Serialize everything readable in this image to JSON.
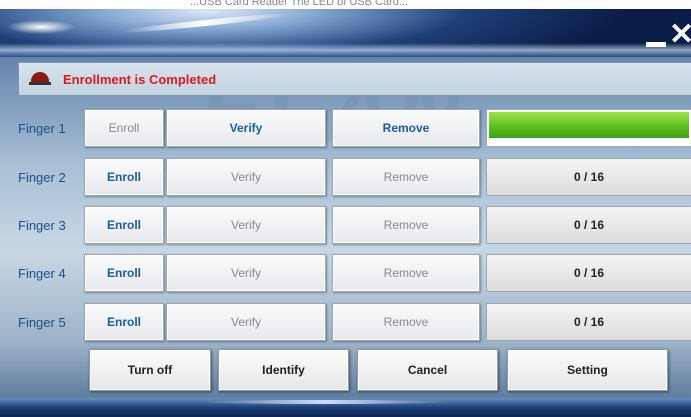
{
  "window": {
    "title_fragment": "...USB Card Reader The LED of USB Card...",
    "minimize_label": "minimize",
    "close_label": "close"
  },
  "status": {
    "message": "Enrollment is Completed",
    "led_color": "#8b1a0f"
  },
  "watermark": "ELAN",
  "fingers": [
    {
      "label": "Finger 1",
      "enroll": "Enroll",
      "verify": "Verify",
      "remove": "Remove",
      "enroll_enabled": false,
      "verify_enabled": true,
      "remove_enabled": true,
      "progress": 1.0,
      "status": ""
    },
    {
      "label": "Finger 2",
      "enroll": "Enroll",
      "verify": "Verify",
      "remove": "Remove",
      "enroll_enabled": true,
      "verify_enabled": false,
      "remove_enabled": false,
      "status": "0 / 16"
    },
    {
      "label": "Finger 3",
      "enroll": "Enroll",
      "verify": "Verify",
      "remove": "Remove",
      "enroll_enabled": true,
      "verify_enabled": false,
      "remove_enabled": false,
      "status": "0 / 16"
    },
    {
      "label": "Finger 4",
      "enroll": "Enroll",
      "verify": "Verify",
      "remove": "Remove",
      "enroll_enabled": true,
      "verify_enabled": false,
      "remove_enabled": false,
      "status": "0 / 16"
    },
    {
      "label": "Finger 5",
      "enroll": "Enroll",
      "verify": "Verify",
      "remove": "Remove",
      "enroll_enabled": true,
      "verify_enabled": false,
      "remove_enabled": false,
      "status": "0 / 16"
    }
  ],
  "bottom": {
    "turn_off": "Turn off",
    "identify": "Identify",
    "cancel": "Cancel",
    "setting": "Setting"
  },
  "colors": {
    "accent_text": "#1a5aa8",
    "label_text": "#1e4f8c",
    "status_text": "#d81a1a",
    "progress_fill": "#5bbd1e"
  }
}
